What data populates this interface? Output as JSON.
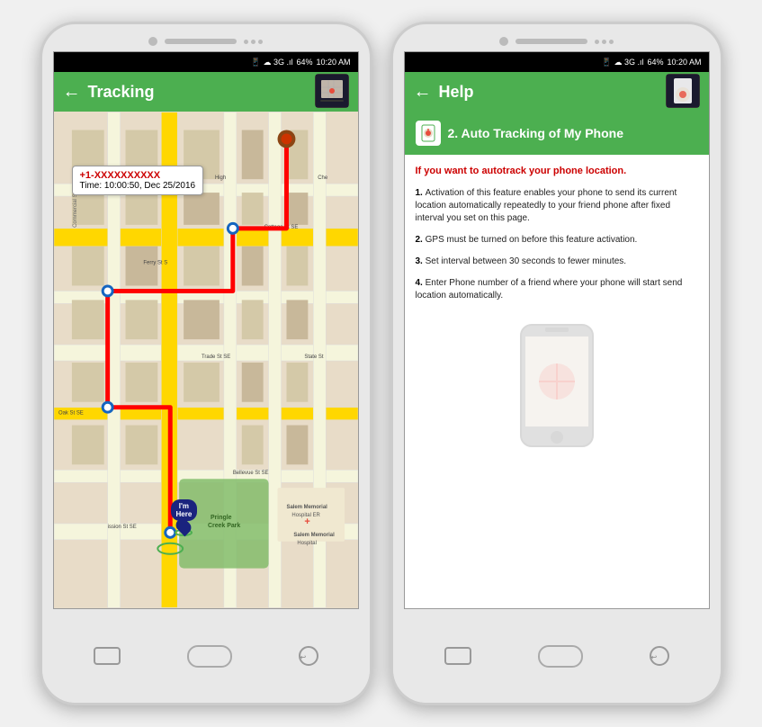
{
  "left_phone": {
    "status_bar": {
      "icons": "📱 ☁ 3G .ıl .ıll",
      "battery": "64%",
      "time": "10:20 AM"
    },
    "app_bar": {
      "back_icon": "←",
      "title": "Tracking"
    },
    "map": {
      "popup_phone": "+1-XXXXXXXXXX",
      "popup_time": "Time: 10:00:50, Dec 25/2016"
    },
    "im_here": "I'm\nHere",
    "nav": {
      "left_btn": "□",
      "center_btn": "○",
      "right_btn": "←"
    }
  },
  "right_phone": {
    "status_bar": {
      "battery": "64%",
      "time": "10:20 AM"
    },
    "app_bar": {
      "back_icon": "←",
      "title": "Help"
    },
    "section_title": "2. Auto Tracking of My Phone",
    "subtitle": "If you want to autotrack your phone location.",
    "items": [
      {
        "num": "1.",
        "text": "Activation of this feature enables your phone to send its current location automatically repeatedly to your friend phone after fixed interval you set on this page."
      },
      {
        "num": "2.",
        "text": "GPS must be turned on before this feature activation."
      },
      {
        "num": "3.",
        "text": "Set interval between 30 seconds to fewer minutes."
      },
      {
        "num": "4.",
        "text": "Enter Phone number of a friend where your phone will start send location automatically."
      }
    ]
  }
}
